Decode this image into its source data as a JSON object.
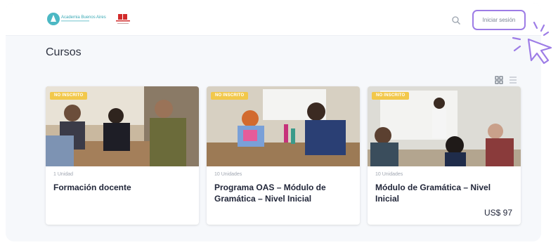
{
  "header": {
    "logo_text": "Academia Buenos Aires",
    "login_label": "Iniciar sesión"
  },
  "page": {
    "title": "Cursos"
  },
  "courses": [
    {
      "badge": "NO INSCRITO",
      "units": "1 Unidad",
      "title": "Formación docente",
      "price": ""
    },
    {
      "badge": "NO INSCRITO",
      "units": "10 Unidades",
      "title": "Programa OAS – Módulo de Gramática – Nivel Inicial",
      "price": ""
    },
    {
      "badge": "NO INSCRITO",
      "units": "10 Unidades",
      "title": "Módulo de Gramática – Nivel Inicial",
      "price": "US$ 97"
    }
  ],
  "colors": {
    "accent": "#9d7ce6",
    "badge": "#f2c84b"
  },
  "icons": {
    "search": "search-icon",
    "grid": "grid-view-icon",
    "list": "list-view-icon",
    "cursor": "cursor-click-icon"
  }
}
